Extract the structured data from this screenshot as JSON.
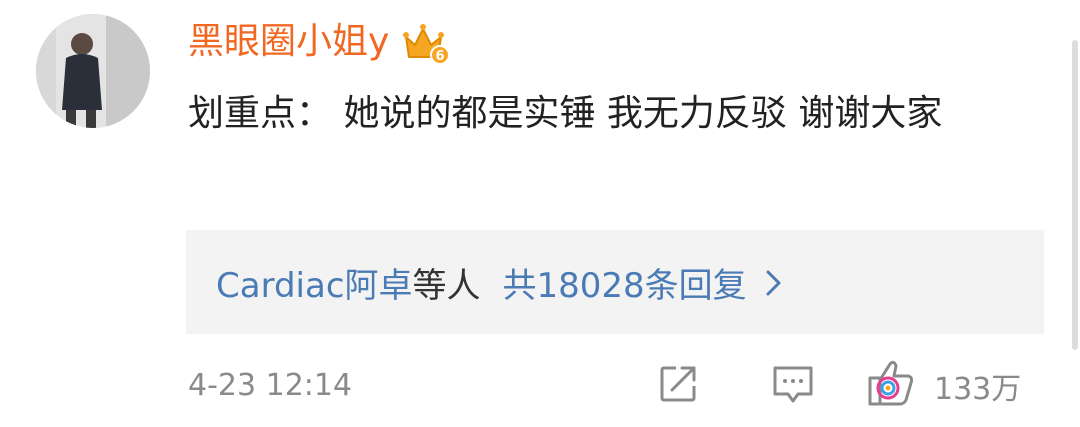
{
  "comment": {
    "author": {
      "username": "黑眼圈小姐y",
      "avatar_icon": "avatar",
      "badge_icon": "vip-crown-icon",
      "badge_level": "6"
    },
    "text": "划重点： 她说的都是实锤 我无力反驳 谢谢大家",
    "replies": {
      "names": "Cardiac阿卓",
      "suffix": "等人",
      "total": "共18028条回复"
    },
    "timestamp": "4-23 12:14",
    "actions": {
      "share_icon": "share-icon",
      "comment_icon": "comment-icon",
      "like_icon": "like-icon",
      "like_count": "133万"
    }
  },
  "colors": {
    "username": "#f26722",
    "link": "#4a7bb5",
    "text": "#222222",
    "meta": "#8a8a8a",
    "reply_bg": "#f3f3f3",
    "crown": "#f5a623"
  }
}
